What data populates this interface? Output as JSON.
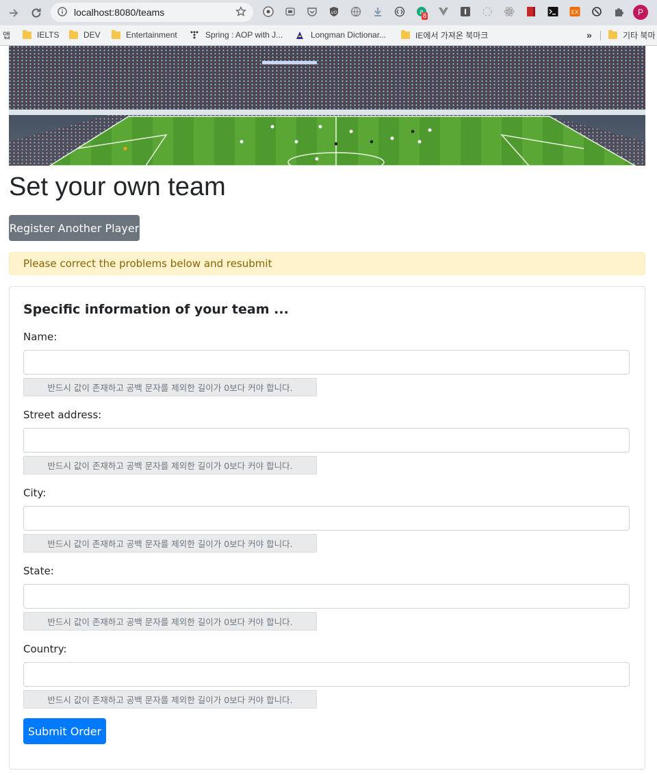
{
  "browser": {
    "url": "localhost:8080/teams",
    "profile_initial": "P",
    "extension_badge": "8",
    "bookmarks_prefix": "앱",
    "bookmarks": [
      {
        "label": "IELTS",
        "icon": "folder-icon"
      },
      {
        "label": "DEV",
        "icon": "folder-icon"
      },
      {
        "label": "Entertainment",
        "icon": "folder-icon"
      },
      {
        "label": "Spring : AOP with J...",
        "icon": "spring-icon"
      },
      {
        "label": "Longman Dictionar...",
        "icon": "longman-icon"
      },
      {
        "label": "IE에서 가져온 북마크",
        "icon": "folder-icon"
      }
    ],
    "overflow_label": "»",
    "other_bookmarks": "기타 북마"
  },
  "page": {
    "title": "Set your own team",
    "register_button": "Register Another Player",
    "alert": "Please correct the problems below and resubmit",
    "section_title": "Specific information of your team ...",
    "fields": [
      {
        "label": "Name:",
        "value": "",
        "error": "반드시 값이 존재하고 공백 문자를 제외한 길이가 0보다 커야 합니다."
      },
      {
        "label": "Street address:",
        "value": "",
        "error": "반드시 값이 존재하고 공백 문자를 제외한 길이가 0보다 커야 합니다."
      },
      {
        "label": "City:",
        "value": "",
        "error": "반드시 값이 존재하고 공백 문자를 제외한 길이가 0보다 커야 합니다."
      },
      {
        "label": "State:",
        "value": "",
        "error": "반드시 값이 존재하고 공백 문자를 제외한 길이가 0보다 커야 합니다."
      },
      {
        "label": "Country:",
        "value": "",
        "error": "반드시 값이 존재하고 공백 문자를 제외한 길이가 0보다 커야 합니다."
      }
    ],
    "submit_button": "Submit Order"
  },
  "colors": {
    "primary": "#007bff",
    "secondary": "#6c757d",
    "alert_bg": "#fff3cd",
    "alert_text": "#856404"
  }
}
